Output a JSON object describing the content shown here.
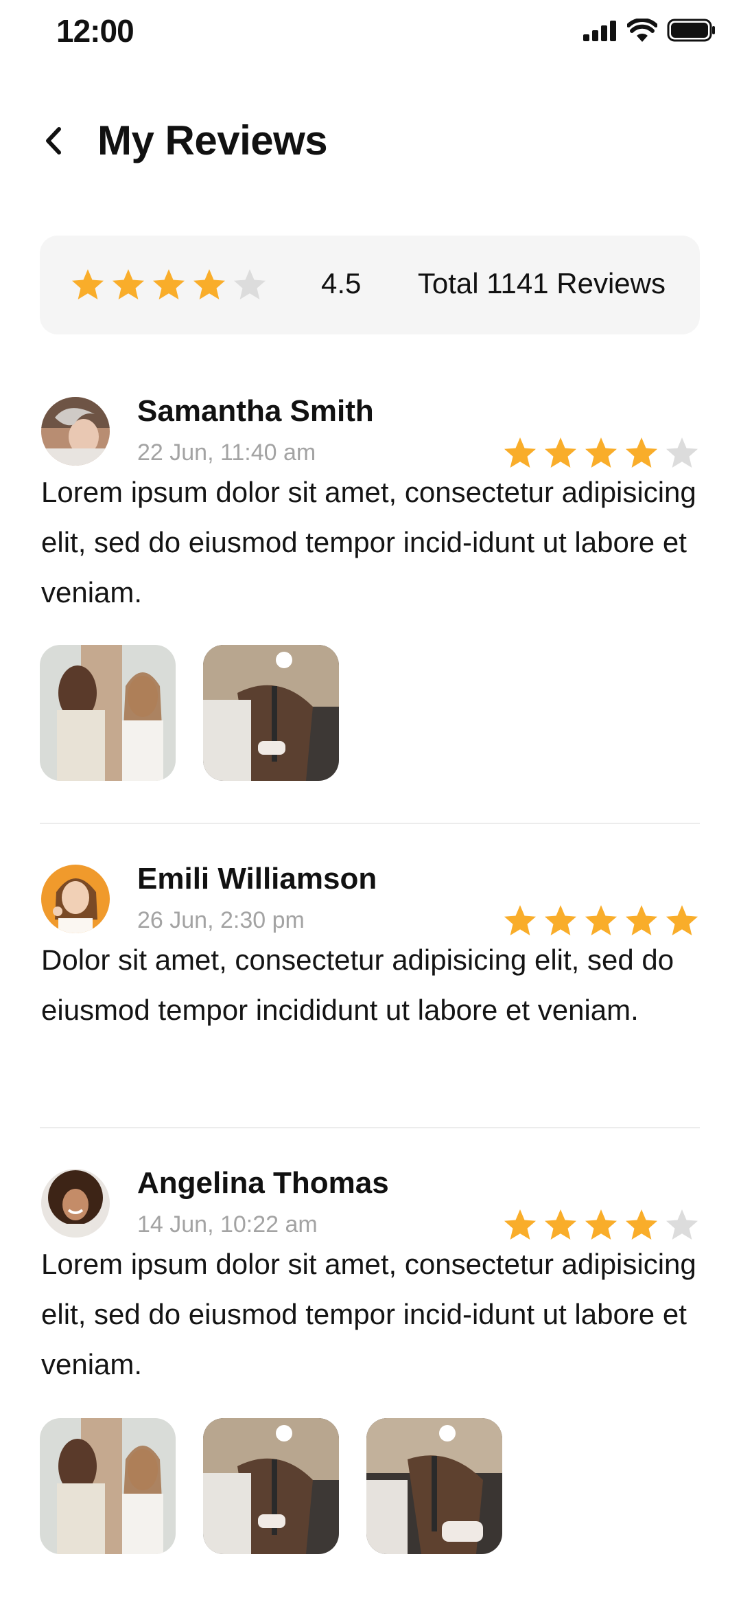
{
  "status_bar": {
    "time": "12:00"
  },
  "header": {
    "title": "My Reviews"
  },
  "summary": {
    "rating": 4.5,
    "rating_label": "4.5",
    "stars_filled": 4,
    "total_label": "Total 1141 Reviews"
  },
  "reviews": [
    {
      "name": "Samantha Smith",
      "date": "22 Jun, 11:40 am",
      "stars": 4,
      "text": "Lorem ipsum dolor sit amet, consectetur adipisicing elit, sed do eiusmod tempor incid-idunt ut labore et veniam.",
      "photo_count": 2
    },
    {
      "name": "Emili Williamson",
      "date": "26 Jun, 2:30 pm",
      "stars": 5,
      "text": "Dolor sit amet, consectetur adipisicing elit, sed do eiusmod tempor incididunt ut labore et veniam.",
      "photo_count": 0
    },
    {
      "name": "Angelina Thomas",
      "date": "14 Jun, 10:22 am",
      "stars": 4,
      "text": "Lorem ipsum dolor sit amet, consectetur adipisicing elit, sed do eiusmod tempor incid-idunt ut labore et veniam.",
      "photo_count": 3
    }
  ],
  "colors": {
    "star_filled": "#f9ad2a",
    "star_empty": "#dcdcdc",
    "card_bg": "#f5f5f5",
    "date_text": "#a3a3a3"
  },
  "icons": {
    "back": "chevron-left-icon",
    "signal": "signal-icon",
    "wifi": "wifi-icon",
    "battery": "battery-icon",
    "star": "star-icon"
  }
}
